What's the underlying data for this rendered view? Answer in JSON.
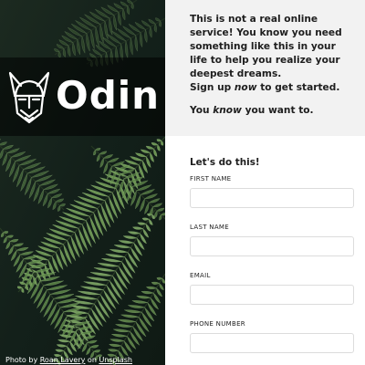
{
  "brand": {
    "name": "Odin"
  },
  "photo_credit": {
    "prefix": "Photo by ",
    "author": "Roan Lavery",
    "middle": " on ",
    "source": "Unsplash"
  },
  "intro": {
    "pitch_1": "This is not a real online service! You know you need something like this in your life to help you realize your deepest dreams.",
    "pitch_2_before": "Sign up ",
    "pitch_2_em": "now",
    "pitch_2_after": " to get started.",
    "tagline_before": "You ",
    "tagline_em": "know",
    "tagline_after": " you want to."
  },
  "form": {
    "title": "Let's do this!",
    "fields": [
      {
        "label": "FIRST NAME",
        "value": "",
        "placeholder": ""
      },
      {
        "label": "LAST NAME",
        "value": "",
        "placeholder": ""
      },
      {
        "label": "EMAIL",
        "value": "",
        "placeholder": ""
      },
      {
        "label": "PHONE NUMBER",
        "value": "",
        "placeholder": ""
      }
    ]
  },
  "colors": {
    "intro_background": "#f2f2f2",
    "text": "#1e1e1e",
    "input_border": "#dcdcdc",
    "photo_dark": "#16221b",
    "fern_green": "#6f9a55"
  },
  "image": {
    "subject": "fern-leaves-photo"
  }
}
